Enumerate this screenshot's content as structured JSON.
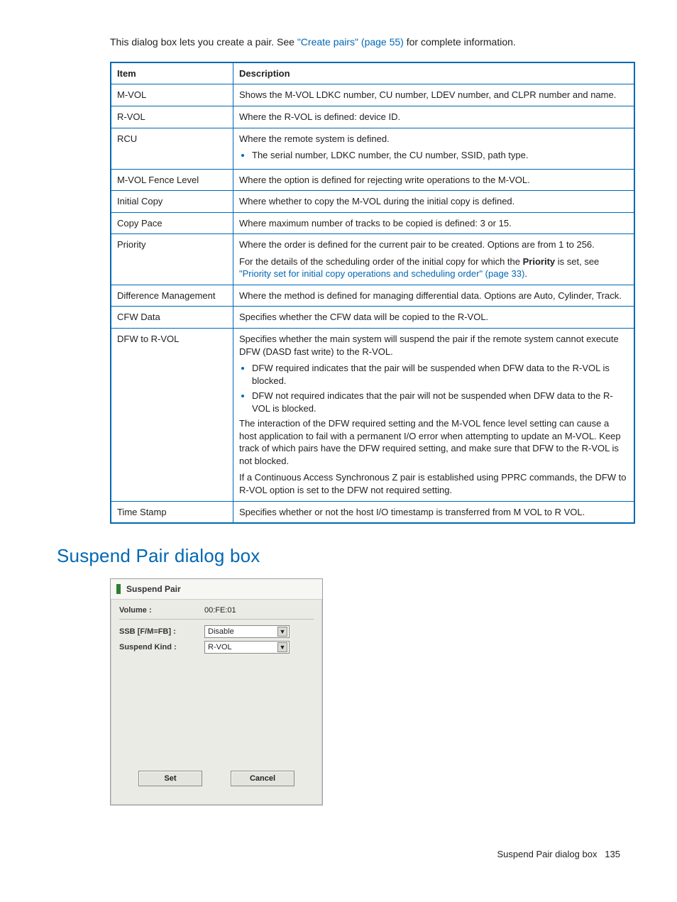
{
  "intro": {
    "before": "This dialog box lets you create a pair. See ",
    "link": "\"Create pairs\" (page 55)",
    "after": " for complete information."
  },
  "table": {
    "header_item": "Item",
    "header_desc": "Description",
    "rows": {
      "mvol": {
        "item": "M-VOL",
        "desc": "Shows the M-VOL LDKC number, CU number, LDEV number, and CLPR number and name."
      },
      "rvol": {
        "item": "R-VOL",
        "desc": "Where the R-VOL is defined: device ID."
      },
      "rcu": {
        "item": "RCU",
        "p1": "Where the remote system is defined.",
        "b1": "The serial number, LDKC number, the CU number, SSID, path type."
      },
      "fence": {
        "item": "M-VOL Fence Level",
        "desc": "Where the option is defined for rejecting write operations to the M-VOL."
      },
      "initial": {
        "item": "Initial Copy",
        "desc": "Where whether to copy the M-VOL during the initial copy is defined."
      },
      "pace": {
        "item": "Copy Pace",
        "desc": "Where maximum number of tracks to be copied is defined: 3 or 15."
      },
      "priority": {
        "item": "Priority",
        "p1": "Where the order is defined for the current pair to be created. Options are from 1 to 256.",
        "p2a": "For the details of the scheduling order of the initial copy for which the ",
        "p2b": "Priority",
        "p2c": " is set, see ",
        "link": "\"Priority set for initial copy operations and scheduling order\" (page 33)",
        "p2d": "."
      },
      "diff": {
        "item": "Difference Management",
        "desc": "Where the method is defined for managing differential data. Options are Auto, Cylinder, Track."
      },
      "cfw": {
        "item": "CFW Data",
        "desc": "Specifies whether the CFW data will be copied to the R-VOL."
      },
      "dfw": {
        "item": "DFW to R-VOL",
        "p1": "Specifies whether the main system will suspend the pair if the remote system cannot execute DFW (DASD fast write) to the R-VOL.",
        "b1": "DFW required indicates that the pair will be suspended when DFW data to the R-VOL is blocked.",
        "b2": "DFW not required indicates that the pair will not be suspended when DFW data to the R-VOL is blocked.",
        "p2": "The interaction of the DFW required setting and the M-VOL fence level setting can cause a host application to fail with a permanent I/O error when attempting to update an M-VOL. Keep track of which pairs have the DFW required setting, and make sure that DFW to the R-VOL is not blocked.",
        "p3": "If a Continuous Access Synchronous Z pair is established using PPRC commands, the DFW to R-VOL option is set to the DFW not required setting."
      },
      "ts": {
        "item": "Time Stamp",
        "desc": "Specifies whether or not the host I/O timestamp is transferred from M VOL to R VOL."
      }
    }
  },
  "section_title": "Suspend Pair dialog box",
  "dialog": {
    "title": "Suspend Pair",
    "volume_label": "Volume :",
    "volume_value": "00:FE:01",
    "ssb_label": "SSB [F/M=FB] :",
    "ssb_value": "Disable",
    "kind_label": "Suspend Kind :",
    "kind_value": "R-VOL",
    "set": "Set",
    "cancel": "Cancel"
  },
  "footer": {
    "text": "Suspend Pair dialog box",
    "page": "135"
  }
}
